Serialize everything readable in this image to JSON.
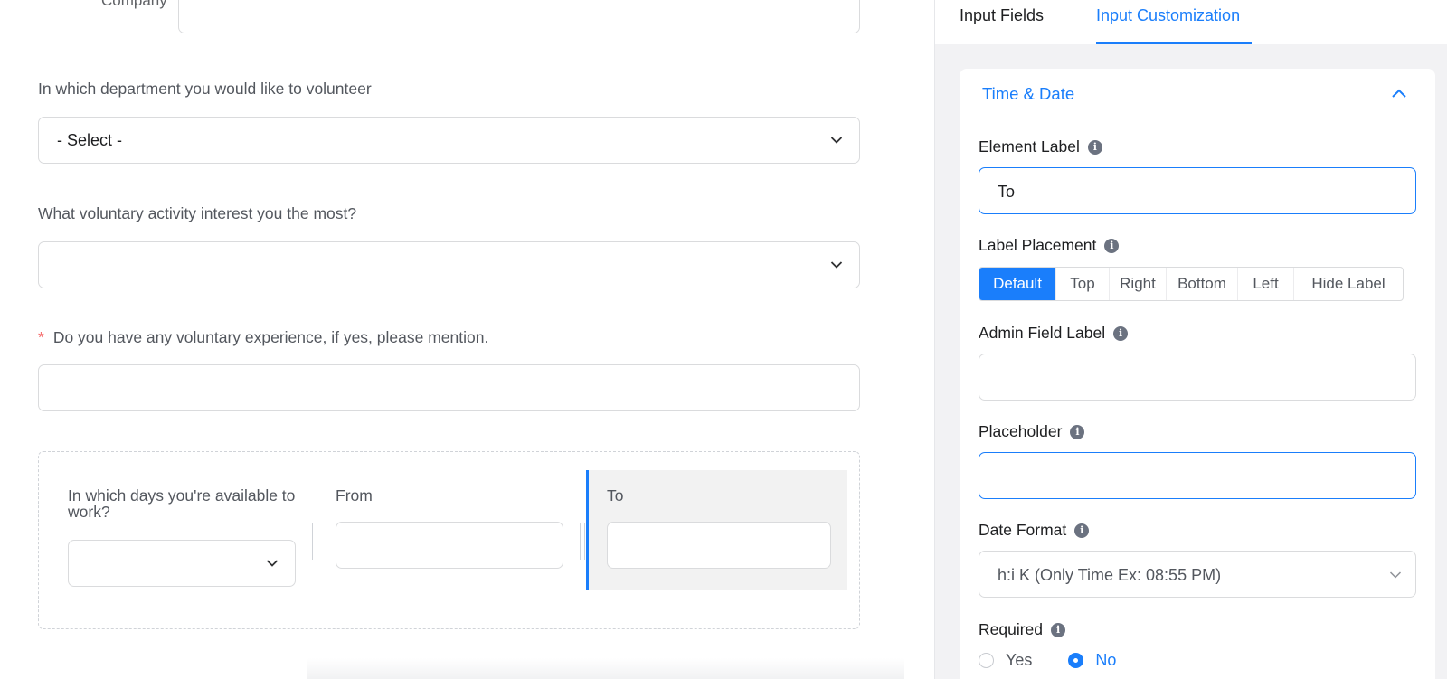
{
  "form": {
    "company_label": "Company",
    "department_label": "In which department you would like to volunteer",
    "department_value": "- Select -",
    "activity_label": "What voluntary activity interest you the most?",
    "activity_value": "",
    "experience_required_marker": "*",
    "experience_label": "Do you have any voluntary experience, if yes, please mention.",
    "container": {
      "days_label": "In which days you're available to work?",
      "from_label": "From",
      "to_label": "To"
    }
  },
  "panel": {
    "tabs": [
      {
        "label": "Input Fields",
        "active": false
      },
      {
        "label": "Input Customization",
        "active": true
      }
    ],
    "section_title": "Time & Date",
    "element_label": {
      "label": "Element Label",
      "value": "To"
    },
    "label_placement": {
      "label": "Label Placement",
      "options": [
        "Default",
        "Top",
        "Right",
        "Bottom",
        "Left",
        "Hide Label"
      ],
      "selected": "Default"
    },
    "admin_field_label": {
      "label": "Admin Field Label",
      "value": ""
    },
    "placeholder": {
      "label": "Placeholder",
      "value": ""
    },
    "date_format": {
      "label": "Date Format",
      "value": "h:i K (Only Time Ex: 08:55 PM)"
    },
    "required": {
      "label": "Required",
      "options": [
        "Yes",
        "No"
      ],
      "selected": "No"
    }
  },
  "colors": {
    "accent": "#1a7efb",
    "required_marker": "#f56c6c",
    "panel_bg": "#f2f2f4"
  },
  "icons": [
    "chevron-down-icon",
    "chevron-up-icon",
    "info-icon"
  ]
}
